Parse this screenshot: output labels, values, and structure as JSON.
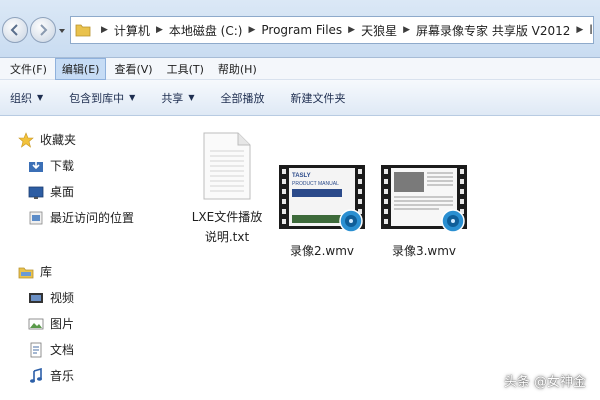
{
  "address": {
    "crumbs": [
      "计算机",
      "本地磁盘 (C:)",
      "Program Files",
      "天狼星",
      "屏幕录像专家 共享版 V2012",
      "ls"
    ]
  },
  "menu": {
    "file": "文件(F)",
    "edit": "编辑(E)",
    "view": "查看(V)",
    "tools": "工具(T)",
    "help": "帮助(H)"
  },
  "commands": {
    "organize": "组织",
    "include": "包含到库中",
    "share": "共享",
    "play_all": "全部播放",
    "new_folder": "新建文件夹"
  },
  "nav": {
    "favorites": "收藏夹",
    "downloads": "下载",
    "desktop": "桌面",
    "recent": "最近访问的位置",
    "library": "库",
    "videos": "视频",
    "pictures": "图片",
    "documents": "文档",
    "music": "音乐"
  },
  "files": [
    {
      "name": "LXE文件播放说明.txt",
      "type": "txt-icon"
    },
    {
      "name": "录像2.wmv",
      "type": "wmv-icon"
    },
    {
      "name": "录像3.wmv",
      "type": "wmv-icon"
    }
  ],
  "watermark": "头条 @女神金",
  "colors": {
    "accent": "#c6dcf5",
    "header_bg": "#dbe8f6"
  }
}
